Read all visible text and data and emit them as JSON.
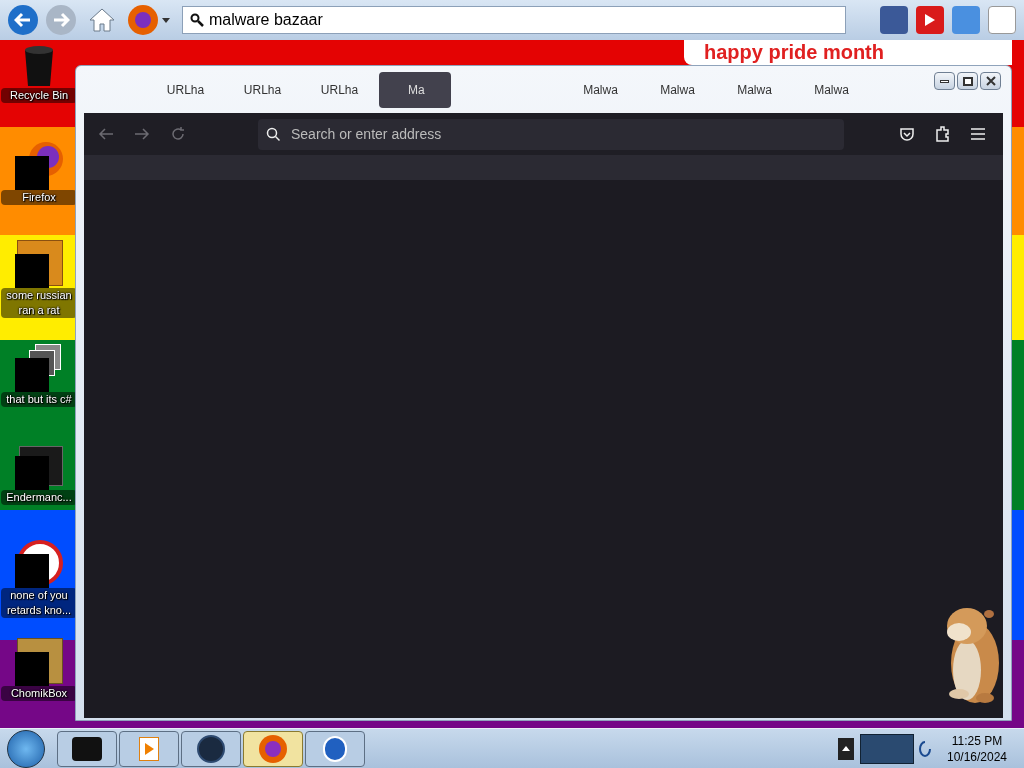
{
  "top_toolbar": {
    "search_value": "malware bazaar"
  },
  "desktop": {
    "banner_text": "happy pride month",
    "icons": [
      {
        "label": "Recycle Bin"
      },
      {
        "label": "Firefox"
      },
      {
        "label": "some russian ran a rat"
      },
      {
        "label": "that but its c#"
      },
      {
        "label": "Endermanc..."
      },
      {
        "label": "none of you retards kno..."
      },
      {
        "label": "ChomikBox"
      }
    ]
  },
  "window": {
    "tabs": [
      {
        "label": "URLha",
        "selected": false
      },
      {
        "label": "URLha",
        "selected": false
      },
      {
        "label": "URLha",
        "selected": false
      },
      {
        "label": "Ma",
        "selected": true
      },
      {
        "label": "Malwa",
        "selected": false
      },
      {
        "label": "Malwa",
        "selected": false
      },
      {
        "label": "Malwa",
        "selected": false
      },
      {
        "label": "Malwa",
        "selected": false
      }
    ],
    "address_placeholder": "Search or enter address"
  },
  "taskbar": {
    "apps": [
      {
        "selected": false
      },
      {
        "selected": false
      },
      {
        "selected": false
      },
      {
        "selected": true
      },
      {
        "selected": false
      }
    ],
    "clock": {
      "time": "11:25 PM",
      "date": "10/16/2024"
    }
  }
}
